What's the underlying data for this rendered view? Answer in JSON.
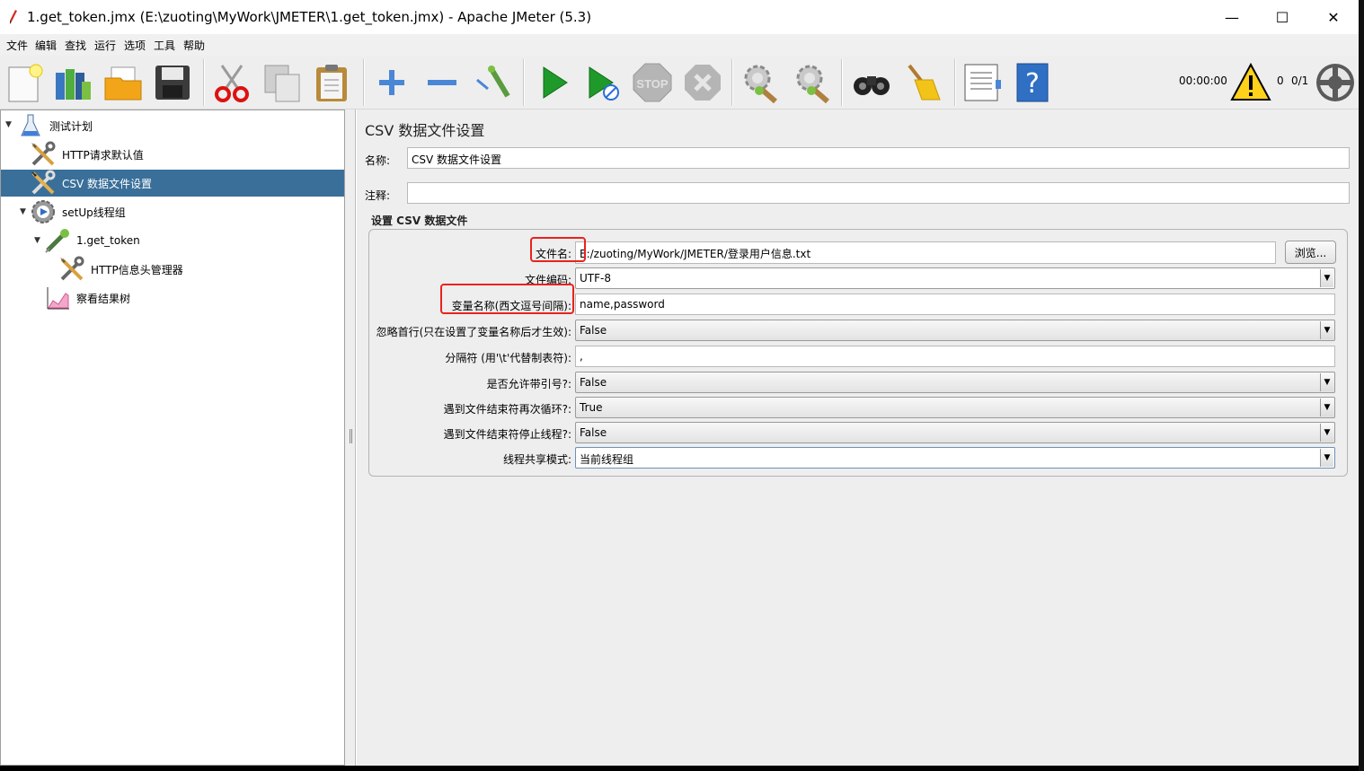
{
  "window": {
    "title": "1.get_token.jmx (E:\\zuoting\\MyWork\\JMETER\\1.get_token.jmx) - Apache JMeter (5.3)",
    "minimize": "—",
    "maximize": "☐",
    "close": "✕"
  },
  "menu": [
    "文件",
    "编辑",
    "查找",
    "运行",
    "选项",
    "工具",
    "帮助"
  ],
  "toolbar": {
    "buttons": [
      "new-icon",
      "templates-icon",
      "open-icon",
      "save-icon",
      "cut-icon",
      "copy-icon",
      "paste-icon",
      "expand-icon",
      "collapse-icon",
      "toggle-icon",
      "start-icon",
      "start-no-pause-icon",
      "stop-icon",
      "shutdown-icon",
      "clear-icon",
      "clear-all-icon",
      "search-icon",
      "reset-search-icon",
      "function-helper-icon",
      "help-icon"
    ],
    "timer": "00:00:00",
    "warning_count": "0",
    "threads": "0/1",
    "stop_label": "STOP"
  },
  "tree": {
    "nodes": [
      {
        "label": "测试计划",
        "icon": "test-plan-icon",
        "expanded": true
      },
      {
        "label": "HTTP请求默认值",
        "icon": "config-wrench-icon"
      },
      {
        "label": "CSV 数据文件设置",
        "icon": "config-wrench-icon",
        "selected": true
      },
      {
        "label": "setUp线程组",
        "icon": "thread-group-gear-icon",
        "expanded": true
      },
      {
        "label": "1.get_token",
        "icon": "sampler-pipette-icon",
        "expanded": true
      },
      {
        "label": "HTTP信息头管理器",
        "icon": "config-wrench-icon"
      },
      {
        "label": "察看结果树",
        "icon": "listener-chart-icon"
      }
    ]
  },
  "editor": {
    "title": "CSV 数据文件设置",
    "name_label": "名称:",
    "name_value": "CSV 数据文件设置",
    "comment_label": "注释:",
    "comment_value": "",
    "group_title": "设置 CSV 数据文件",
    "browse_label": "浏览...",
    "fields": [
      {
        "label": "文件名:",
        "value": "E:/zuoting/MyWork/JMETER/登录用户信息.txt",
        "type": "text"
      },
      {
        "label": "文件编码:",
        "value": "UTF-8",
        "type": "combo"
      },
      {
        "label": "变量名称(西文逗号间隔):",
        "value": "name,password",
        "type": "text"
      },
      {
        "label": "忽略首行(只在设置了变量名称后才生效):",
        "value": "False",
        "type": "combo"
      },
      {
        "label": "分隔符 (用'\\t'代替制表符):",
        "value": ",",
        "type": "text"
      },
      {
        "label": "是否允许带引号?:",
        "value": "False",
        "type": "combo"
      },
      {
        "label": "遇到文件结束符再次循环?:",
        "value": "True",
        "type": "combo"
      },
      {
        "label": "遇到文件结束符停止线程?:",
        "value": "False",
        "type": "combo"
      },
      {
        "label": "线程共享模式:",
        "value": "当前线程组",
        "type": "combo"
      }
    ]
  },
  "colors": {
    "selection": "#3a6f99",
    "highlight": "#e8231d"
  }
}
